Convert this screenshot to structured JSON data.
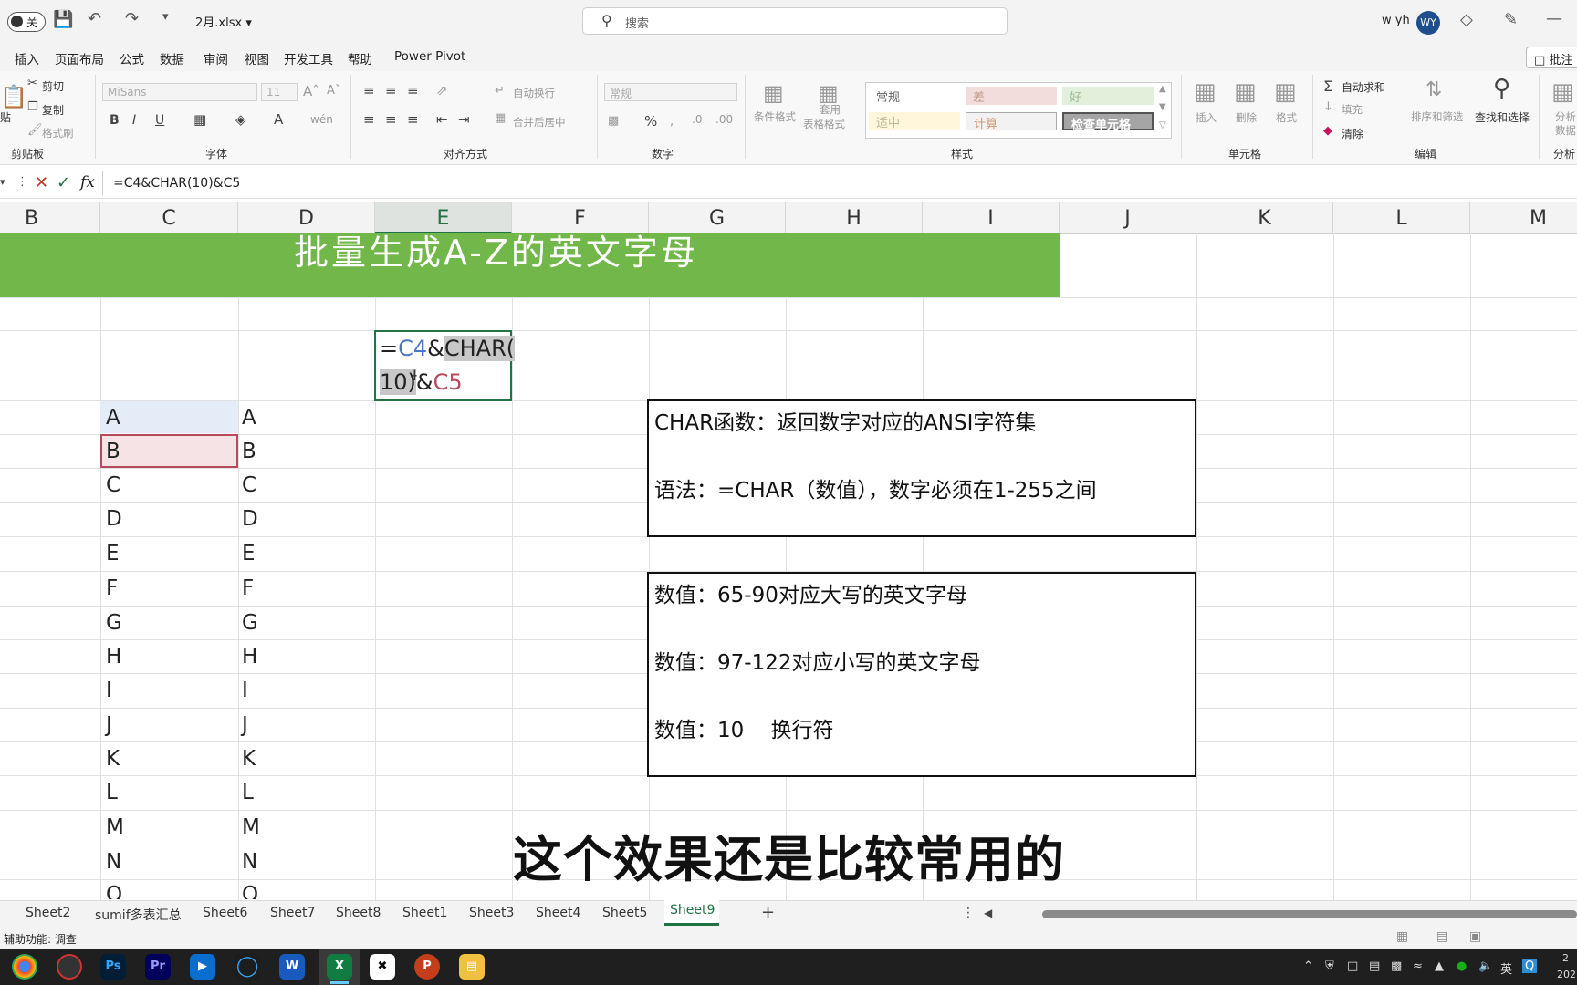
{
  "titlebar": {
    "toggle_label": "关",
    "filename": "2月.xlsx",
    "search_placeholder": "搜索",
    "user": "w yh",
    "avatar": "WY"
  },
  "menu": [
    "插入",
    "页面布局",
    "公式",
    "数据",
    "审阅",
    "视图",
    "开发工具",
    "帮助",
    "Power Pivot"
  ],
  "comment_button": "批注",
  "ribbon": {
    "clipboard": {
      "paste": "贴",
      "cut": "剪切",
      "copy": "复制",
      "format_painter": "格式刷",
      "group": "剪贴板"
    },
    "font": {
      "name": "MiSans",
      "size": "11",
      "group": "字体"
    },
    "alignment": {
      "wrap": "自动换行",
      "merge": "合并后居中",
      "group": "对齐方式"
    },
    "number": {
      "format": "常规",
      "group": "数字"
    },
    "styles": {
      "conditional": "条件格式",
      "table_format_1": "套用",
      "table_format_2": "表格格式",
      "group": "样式",
      "normal": "常规",
      "bad": "差",
      "good": "好",
      "neutral": "适中",
      "calc": "计算",
      "check": "检查单元格"
    },
    "cells": {
      "insert": "插入",
      "delete": "删除",
      "format": "格式",
      "group": "单元格"
    },
    "editing": {
      "autosum": "自动求和",
      "fill": "填充",
      "clear": "清除",
      "sort": "排序和筛选",
      "find": "查找和选择",
      "group": "编辑"
    },
    "analysis": {
      "label": "分析",
      "label2": "数据",
      "group": "分析"
    }
  },
  "formula_bar": {
    "formula": "=C4&CHAR(10)&C5"
  },
  "columns": [
    "B",
    "C",
    "D",
    "E",
    "F",
    "G",
    "H",
    "I",
    "J",
    "K",
    "L",
    "M"
  ],
  "banner_text": "批量生成A-Z的英文字母",
  "edit_cell": {
    "eq": "=",
    "r1": "C4",
    "amp1": "&",
    "fn1": "CHAR(",
    "fn2": "10)",
    "amp2": "&",
    "r2": "C5"
  },
  "letters": [
    "A",
    "B",
    "C",
    "D",
    "E",
    "F",
    "G",
    "H",
    "I",
    "J",
    "K",
    "L",
    "M",
    "N",
    "O"
  ],
  "note1": {
    "line1": "CHAR函数：返回数字对应的ANSI字符集",
    "line2": "语法：=CHAR（数值），数字必须在1-255之间"
  },
  "note2": {
    "line1": "数值：65-90对应大写的英文字母",
    "line2": "数值：97-122对应小写的英文字母",
    "line3": "数值：10    换行符"
  },
  "subtitle": "这个效果还是比较常用的",
  "sheet_tabs": [
    "Sheet2",
    "sumif多表汇总",
    "Sheet6",
    "Sheet7",
    "Sheet8",
    "Sheet1",
    "Sheet3",
    "Sheet4",
    "Sheet5"
  ],
  "active_tab": "Sheet9",
  "add_sheet": "+",
  "status_text": "辅助功能: 调查",
  "taskbar_apps": [
    "Ps",
    "Pr",
    "W",
    "X",
    "P"
  ],
  "tray": {
    "ime": "英",
    "clock1": "2",
    "clock2": "202"
  },
  "colors": {
    "excel_green": "#217346",
    "banner": "#72b74a",
    "ref_blue": "#4a78c4",
    "ref_red": "#b84a5e"
  }
}
